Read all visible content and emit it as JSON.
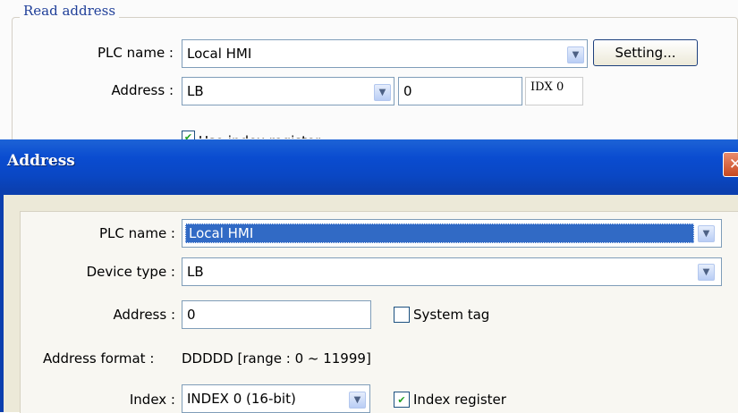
{
  "read_address": {
    "group_title": "Read address",
    "plc_name_label": "PLC name :",
    "plc_name_value": "Local HMI",
    "setting_button": "Setting...",
    "address_label": "Address :",
    "device_value": "LB",
    "address_value": "0",
    "index_text": "IDX 0",
    "use_index_label": "Use index register"
  },
  "dialog": {
    "title": "Address",
    "close_glyph": "✕",
    "plc_name_label": "PLC name :",
    "plc_name_value": "Local HMI",
    "device_type_label": "Device type :",
    "device_type_value": "LB",
    "address_label": "Address :",
    "address_value": "0",
    "system_tag_label": "System tag",
    "system_tag_checked": false,
    "address_format_label": "Address format :",
    "address_format_value": "DDDDD [range : 0 ~ 11999]",
    "index_label": "Index :",
    "index_value": "INDEX 0 (16-bit)",
    "index_register_label": "Index register",
    "index_register_checked": true
  },
  "icons": {
    "dropdown": "▼",
    "check": "✔"
  },
  "colors": {
    "titlebar": "#0a4cd0",
    "selection": "#316ac5",
    "dialog_body": "#ece9d8",
    "group_title": "#1f3f99"
  }
}
